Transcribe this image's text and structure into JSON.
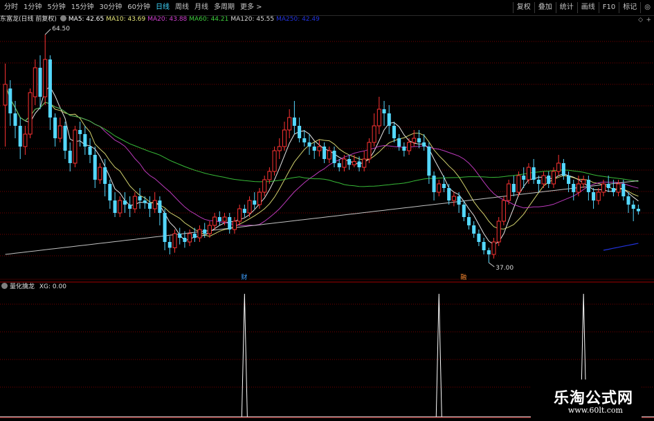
{
  "toolbar": {
    "period_tabs": [
      {
        "label": "分时",
        "active": false
      },
      {
        "label": "1分钟",
        "active": false
      },
      {
        "label": "5分钟",
        "active": false
      },
      {
        "label": "15分钟",
        "active": false
      },
      {
        "label": "30分钟",
        "active": false
      },
      {
        "label": "60分钟",
        "active": false
      },
      {
        "label": "日线",
        "active": true
      },
      {
        "label": "周线",
        "active": false
      },
      {
        "label": "月线",
        "active": false
      },
      {
        "label": "多周期",
        "active": false
      },
      {
        "label": "更多 >",
        "active": false
      }
    ],
    "tools": [
      "复权",
      "叠加",
      "统计",
      "画线",
      "F10",
      "标记",
      "◎"
    ]
  },
  "main_chart": {
    "stock_title": "东富龙(日线 前复权)",
    "ma": [
      {
        "label": "MA5: 42.65",
        "color": "#ffffff"
      },
      {
        "label": "MA10: 43.69",
        "color": "#e8e87a"
      },
      {
        "label": "MA20: 43.88",
        "color": "#d040d0"
      },
      {
        "label": "MA60: 44.21",
        "color": "#3ecf3e"
      },
      {
        "label": "MA120: 45.55",
        "color": "#d8d8d8"
      },
      {
        "label": "MA250: 42.49",
        "color": "#2233dd"
      }
    ],
    "high_label": "64.50",
    "low_label": "37.00",
    "markers": [
      "财",
      "融"
    ],
    "colors": {
      "up": "#ff3333",
      "down": "#54d8ff",
      "grid": "#7a0000"
    }
  },
  "indicator": {
    "name": "量化擒龙",
    "value_label": "XG: 0.00"
  },
  "watermark": {
    "title": "乐淘公式网",
    "url": "www.60lt.com"
  },
  "chart_data": {
    "type": "candlestick",
    "title": "东富龙(日线 前复权)",
    "ylim": [
      37.0,
      64.5
    ],
    "candles": [
      [
        56,
        58.5,
        51,
        61
      ],
      [
        58,
        55,
        53.5,
        59
      ],
      [
        55,
        53.5,
        52,
        56.5
      ],
      [
        53.5,
        51,
        49.5,
        54.5
      ],
      [
        51,
        52.5,
        50,
        53.5
      ],
      [
        52.5,
        57.5,
        52,
        58
      ],
      [
        57,
        60.5,
        56,
        61.5
      ],
      [
        60.5,
        57,
        55.5,
        62
      ],
      [
        57,
        61.5,
        56,
        64.5
      ],
      [
        61.5,
        54.5,
        53,
        62
      ],
      [
        54.5,
        52,
        51,
        55
      ],
      [
        52,
        53.5,
        51.5,
        54.5
      ],
      [
        53.5,
        50.5,
        49.5,
        54
      ],
      [
        50.5,
        49,
        48,
        51.5
      ],
      [
        49,
        53,
        48.5,
        53.5
      ],
      [
        53,
        52.5,
        51,
        54
      ],
      [
        52.5,
        51,
        50,
        53.5
      ],
      [
        51,
        50,
        49,
        52
      ],
      [
        50,
        47,
        46,
        51
      ],
      [
        47,
        48.5,
        46.5,
        49
      ],
      [
        48.5,
        46.5,
        45,
        49.5
      ],
      [
        46.5,
        44.5,
        43.5,
        47
      ],
      [
        44.5,
        43,
        42.5,
        45.5
      ],
      [
        43,
        44.5,
        42.5,
        45
      ],
      [
        44.5,
        44,
        43,
        45.5
      ],
      [
        44,
        43.5,
        42.5,
        45
      ],
      [
        43.5,
        45,
        43,
        45.5
      ],
      [
        45,
        44.5,
        43.5,
        46
      ],
      [
        44.5,
        44.2,
        43.5,
        45
      ],
      [
        44.2,
        43.5,
        42.5,
        45
      ],
      [
        43.5,
        44.5,
        43,
        45.5
      ],
      [
        44.5,
        43,
        41.5,
        45
      ],
      [
        43,
        39.5,
        38.5,
        43.5
      ],
      [
        39.5,
        38.8,
        38,
        40.2
      ],
      [
        38.8,
        40.5,
        38.2,
        41
      ],
      [
        40.5,
        40,
        39.2,
        41.2
      ],
      [
        40,
        39.5,
        38.8,
        40.8
      ],
      [
        39.5,
        40.5,
        39,
        41
      ],
      [
        40.5,
        40,
        39.5,
        41.2
      ],
      [
        40,
        41,
        39.5,
        41.5
      ],
      [
        41,
        40.5,
        40,
        41.8
      ],
      [
        40.5,
        41.5,
        40,
        42
      ],
      [
        41.5,
        42.5,
        41,
        43
      ],
      [
        42.5,
        42,
        41.5,
        43.2
      ],
      [
        42,
        42.5,
        41.5,
        43
      ],
      [
        42.5,
        41,
        40.5,
        43
      ],
      [
        41,
        42,
        40.5,
        42.5
      ],
      [
        42,
        43.5,
        41.5,
        44
      ],
      [
        43.5,
        43,
        42.5,
        44
      ],
      [
        43,
        44.5,
        42.5,
        45
      ],
      [
        44.5,
        44,
        43.5,
        45.5
      ],
      [
        44,
        45.5,
        43.5,
        46
      ],
      [
        45.5,
        47,
        45,
        47.5
      ],
      [
        47,
        48,
        46.5,
        48.5
      ],
      [
        48,
        50.5,
        47.5,
        51
      ],
      [
        50.5,
        51,
        49.5,
        52
      ],
      [
        51,
        53,
        50.5,
        54
      ],
      [
        53,
        54.5,
        52,
        55.5
      ],
      [
        54.5,
        53.5,
        52.5,
        56.5
      ],
      [
        53.5,
        52,
        51.5,
        54.5
      ],
      [
        52,
        51.5,
        51,
        53
      ],
      [
        51.5,
        51,
        50,
        52.5
      ],
      [
        51,
        50.5,
        49.5,
        51.5
      ],
      [
        50.5,
        51,
        49.8,
        51.8
      ],
      [
        51,
        49.5,
        49,
        51.5
      ],
      [
        49.5,
        50.5,
        49,
        51
      ],
      [
        50.5,
        49,
        48.5,
        51
      ],
      [
        49,
        48.5,
        48,
        49.5
      ],
      [
        48.5,
        49.5,
        48,
        50
      ],
      [
        49.5,
        48.8,
        48.2,
        50
      ],
      [
        48.8,
        49.2,
        48.5,
        50
      ],
      [
        49.2,
        48.5,
        48,
        49.8
      ],
      [
        48.5,
        49.5,
        48,
        50.5
      ],
      [
        49.5,
        51.5,
        49,
        52
      ],
      [
        51.5,
        53.5,
        51,
        55
      ],
      [
        53.5,
        55.5,
        52.5,
        57
      ],
      [
        55.5,
        55,
        53.5,
        56.5
      ],
      [
        55,
        53.5,
        52.5,
        56
      ],
      [
        53.5,
        52,
        51.5,
        54
      ],
      [
        52,
        51,
        50.5,
        52.5
      ],
      [
        51,
        50.5,
        49.8,
        51.5
      ],
      [
        50.5,
        51.5,
        50,
        52
      ],
      [
        51.5,
        52,
        51,
        53
      ],
      [
        52,
        51.5,
        50.8,
        53
      ],
      [
        51.5,
        51,
        50.5,
        52.5
      ],
      [
        51,
        47.5,
        46.5,
        51.5
      ],
      [
        47.5,
        45.5,
        44.5,
        48
      ],
      [
        45.5,
        46.5,
        45,
        47
      ],
      [
        46.5,
        46,
        45.5,
        47.5
      ],
      [
        46,
        44.5,
        44,
        46.5
      ],
      [
        44.5,
        45,
        43.8,
        45.5
      ],
      [
        45,
        44,
        43,
        45.5
      ],
      [
        44,
        42.5,
        42,
        44.5
      ],
      [
        42.5,
        41.5,
        41,
        43
      ],
      [
        41.5,
        40.5,
        40,
        42
      ],
      [
        40.5,
        39.5,
        39,
        41
      ],
      [
        39.5,
        38.5,
        38,
        40
      ],
      [
        38.5,
        38,
        37,
        38.8
      ],
      [
        38,
        39.5,
        37.5,
        40
      ],
      [
        39.5,
        42,
        39,
        42.5
      ],
      [
        42,
        44.5,
        41.5,
        45
      ],
      [
        44.5,
        46.5,
        44,
        47
      ],
      [
        46.5,
        45.5,
        45,
        47.5
      ],
      [
        45.5,
        47.5,
        45,
        48
      ],
      [
        47.5,
        47,
        46,
        48.5
      ],
      [
        47,
        48.5,
        46.5,
        49
      ],
      [
        48.5,
        47,
        46.5,
        49.5
      ],
      [
        47,
        46.5,
        45.5,
        47.5
      ],
      [
        46.5,
        47.5,
        46,
        48
      ],
      [
        47.5,
        46.5,
        46,
        48
      ],
      [
        46.5,
        48,
        46,
        48.5
      ],
      [
        48,
        49,
        47.5,
        50
      ],
      [
        49,
        47.5,
        47,
        49.5
      ],
      [
        47.5,
        46.5,
        45.5,
        48
      ],
      [
        46.5,
        45.5,
        44.5,
        47
      ],
      [
        45.5,
        46.5,
        45,
        47.5
      ],
      [
        46.5,
        47,
        46,
        47.5
      ],
      [
        47,
        45.5,
        44.5,
        47.5
      ],
      [
        45.5,
        44.5,
        43.5,
        46
      ],
      [
        44.5,
        45.5,
        44,
        46
      ],
      [
        45.5,
        46.5,
        45,
        47
      ],
      [
        46.5,
        46,
        45.5,
        47.5
      ],
      [
        46,
        45.5,
        45,
        47
      ],
      [
        45.5,
        46.5,
        45,
        47
      ],
      [
        46.5,
        45,
        44.5,
        47
      ],
      [
        45,
        44,
        43,
        45.5
      ],
      [
        44,
        43.5,
        42,
        44.5
      ],
      [
        43.5,
        43.2,
        42.8,
        44
      ]
    ],
    "signals": [
      {
        "index": 48,
        "value": 1
      },
      {
        "index": 87,
        "value": 1
      },
      {
        "index": 116,
        "value": 1
      }
    ]
  }
}
